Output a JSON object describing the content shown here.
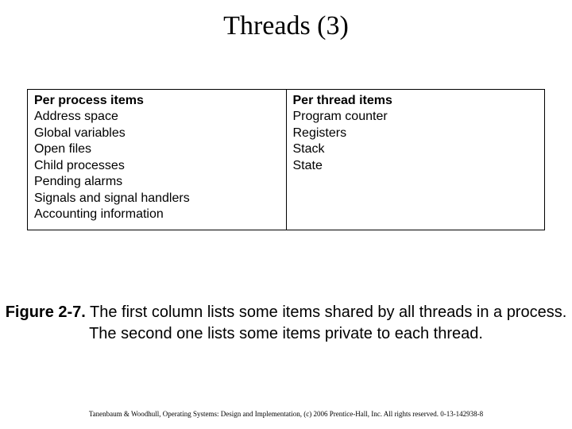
{
  "title": "Threads (3)",
  "table": {
    "col1_head": "Per process items",
    "col2_head": "Per thread items",
    "col1_items": [
      "Address space",
      "Global variables",
      "Open files",
      "Child processes",
      "Pending alarms",
      "Signals and signal handlers",
      "Accounting information"
    ],
    "col2_items": [
      "Program counter",
      "Registers",
      "Stack",
      "State"
    ]
  },
  "caption": {
    "label": "Figure 2-7.",
    "text": " The first column lists some items shared by all threads in a process. The second one lists some items private to each thread."
  },
  "footer": "Tanenbaum & Woodhull, Operating Systems: Design and Implementation, (c) 2006 Prentice-Hall, Inc. All rights reserved. 0-13-142938-8"
}
